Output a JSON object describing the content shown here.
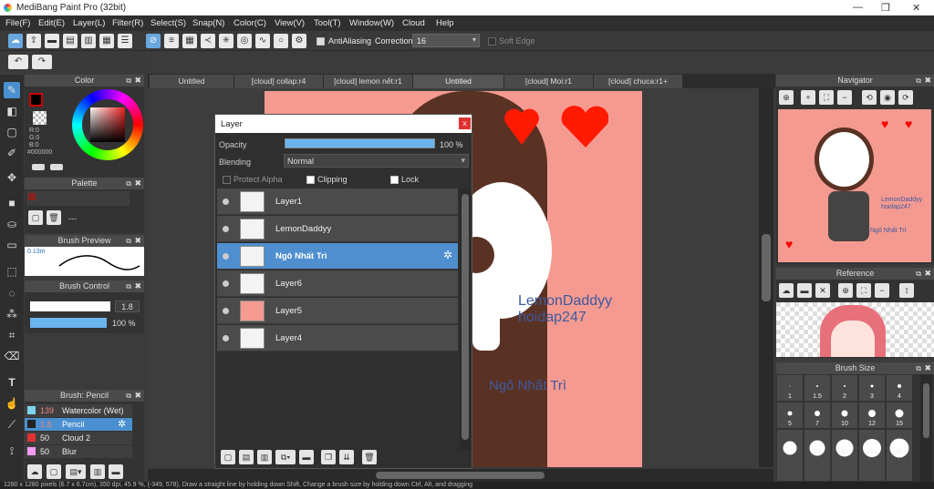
{
  "app": {
    "title": "MediBang Paint Pro (32bit)"
  },
  "menu": [
    "File(F)",
    "Edit(E)",
    "Layer(L)",
    "Filter(R)",
    "Select(S)",
    "Snap(N)",
    "Color(C)",
    "View(V)",
    "Tool(T)",
    "Window(W)",
    "Cloud",
    "Help"
  ],
  "toolbar": {
    "antialiasing_label": "AntiAliasing",
    "correction_label": "Correction",
    "correction_value": "16",
    "soft_edge_label": "Soft Edge"
  },
  "tabs": [
    "Untitled",
    "[cloud] collap:r4",
    "[cloud] lemon nết:r1",
    "Untitled",
    "[cloud] Moi:r1",
    "[cloud] chuca:r1+"
  ],
  "color_panel": {
    "title": "Color",
    "r": "R:0",
    "g": "G:0",
    "b": "B:0",
    "hex": "#000000"
  },
  "palette_panel": {
    "title": "Palette",
    "value": "---"
  },
  "brush_preview": {
    "title": "Brush Preview",
    "size": "0.13m"
  },
  "brush_control": {
    "title": "Brush Control",
    "size": "1.8",
    "opacity": "100 %"
  },
  "brush_list": {
    "title": "Brush: Pencil",
    "items": [
      {
        "size": "139",
        "name": "Watercolor (Wet)",
        "color": "#7fd4ee"
      },
      {
        "size": "1.8",
        "name": "Pencil",
        "color": "#222222"
      },
      {
        "size": "50",
        "name": "Cloud 2",
        "color": "#e03333"
      },
      {
        "size": "50",
        "name": "Blur",
        "color": "#f29cf2"
      }
    ]
  },
  "layer_window": {
    "title": "Layer",
    "opacity_label": "Opacity",
    "opacity_value": "100 %",
    "blending_label": "Blending",
    "blending_value": "Normal",
    "protect_alpha": "Protect Alpha",
    "clipping": "Clipping",
    "lock": "Lock",
    "layers": [
      "Layer1",
      "LemonDaddyy",
      "Ngô Nhất Trì",
      "Layer6",
      "Layer5",
      "Layer4"
    ],
    "selected_index": 2
  },
  "canvas": {
    "text1": "LemonDaddyy",
    "text2": "hoidap247",
    "text3": "Ngô Nhất Trì",
    "bg_color": "#f59a90"
  },
  "navigator": {
    "title": "Navigator",
    "text1": "LemonDaddyy",
    "text2": "hoidap247",
    "text3": "Ngô Nhất Trì"
  },
  "reference": {
    "title": "Reference"
  },
  "brush_size": {
    "title": "Brush Size",
    "sizes": [
      "1",
      "1.5",
      "2",
      "3",
      "4",
      "5",
      "7",
      "10",
      "12",
      "15",
      "20",
      "25",
      "30",
      "40",
      "50"
    ]
  },
  "status": {
    "text": "1280 x 1280 pixels (6.7 x 6.7cm), 350 dpi, 45.9 %, (-349, 578), Draw a straight line by holding down Shift, Change a brush size by holding down Ctrl, Alt, and dragging"
  }
}
